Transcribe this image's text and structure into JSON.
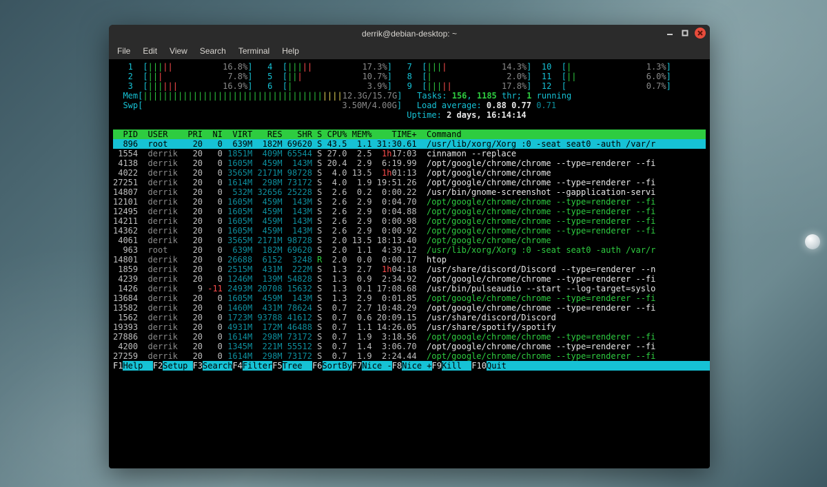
{
  "window": {
    "title": "derrik@debian-desktop: ~",
    "menu": [
      "File",
      "Edit",
      "View",
      "Search",
      "Terminal",
      "Help"
    ]
  },
  "cpu": [
    {
      "n": "1",
      "pct": "16.8%",
      "bars": "GGGRR"
    },
    {
      "n": "2",
      "pct": "7.8%",
      "bars": "GGR"
    },
    {
      "n": "3",
      "pct": "16.9%",
      "bars": "GGGRRR"
    },
    {
      "n": "4",
      "pct": "17.3%",
      "bars": "GGGRR"
    },
    {
      "n": "5",
      "pct": "10.7%",
      "bars": "GGR"
    },
    {
      "n": "6",
      "pct": "3.9%",
      "bars": "G"
    },
    {
      "n": "7",
      "pct": "14.3%",
      "bars": "GGGR"
    },
    {
      "n": "8",
      "pct": "2.0%",
      "bars": "G"
    },
    {
      "n": "9",
      "pct": "17.8%",
      "bars": "GGGRR"
    },
    {
      "n": "10",
      "pct": "1.3%",
      "bars": "G"
    },
    {
      "n": "11",
      "pct": "6.0%",
      "bars": "GG"
    },
    {
      "n": "12",
      "pct": "0.7%",
      "bars": ""
    }
  ],
  "mem": {
    "label": "Mem",
    "used": "12.3G",
    "total": "15.7G"
  },
  "swp": {
    "label": "Swp",
    "used": "3.50M",
    "total": "4.00G"
  },
  "tasks": {
    "label": "Tasks: ",
    "procs": "156",
    "sep1": ", ",
    "thr": "1185",
    "thr_lbl": " thr; ",
    "run": "1",
    "run_lbl": " running"
  },
  "load": {
    "label": "Load average: ",
    "l1": "0.88",
    "l2": "0.77",
    "l3": "0.71"
  },
  "uptime": {
    "label": "Uptime: ",
    "val": "2 days, 16:14:14"
  },
  "columns": [
    "PID",
    "USER",
    "PRI",
    "NI",
    "VIRT",
    "RES",
    "SHR",
    "S",
    "CPU%",
    "MEM%",
    "TIME+",
    "Command"
  ],
  "processes": [
    {
      "pid": "896",
      "user": "root",
      "pri": "20",
      "ni": "0",
      "virt": "639M",
      "res": "182M",
      "shr": "69620",
      "s": "S",
      "cpu": "43.5",
      "mem": "1.1",
      "time": "31:30.61",
      "cmd": "/usr/lib/xorg/Xorg :0 -seat seat0 -auth /var/r",
      "sel": true,
      "time_red": false,
      "cmd_green": false
    },
    {
      "pid": "1554",
      "user": "derrik",
      "pri": "20",
      "ni": "0",
      "virt": "1851M",
      "res": "409M",
      "shr": "65544",
      "s": "S",
      "cpu": "27.0",
      "mem": "2.5",
      "time": "1h17:03",
      "cmd": "cinnamon --replace",
      "time_red": true
    },
    {
      "pid": "4138",
      "user": "derrik",
      "pri": "20",
      "ni": "0",
      "virt": "1605M",
      "res": "459M",
      "shr": "143M",
      "s": "S",
      "cpu": "20.4",
      "mem": "2.9",
      "time": "6:19.99",
      "cmd": "/opt/google/chrome/chrome --type=renderer --fi"
    },
    {
      "pid": "4022",
      "user": "derrik",
      "pri": "20",
      "ni": "0",
      "virt": "3565M",
      "res": "2171M",
      "shr": "98728",
      "s": "S",
      "cpu": "4.0",
      "mem": "13.5",
      "time": "1h01:13",
      "cmd": "/opt/google/chrome/chrome",
      "time_red": true
    },
    {
      "pid": "27251",
      "user": "derrik",
      "pri": "20",
      "ni": "0",
      "virt": "1614M",
      "res": "298M",
      "shr": "73172",
      "s": "S",
      "cpu": "4.0",
      "mem": "1.9",
      "time": "19:51.26",
      "cmd": "/opt/google/chrome/chrome --type=renderer --fi"
    },
    {
      "pid": "14807",
      "user": "derrik",
      "pri": "20",
      "ni": "0",
      "virt": "532M",
      "res": "32656",
      "shr": "25228",
      "s": "S",
      "cpu": "2.6",
      "mem": "0.2",
      "time": "0:00.22",
      "cmd": "/usr/bin/gnome-screenshot --gapplication-servi"
    },
    {
      "pid": "12101",
      "user": "derrik",
      "pri": "20",
      "ni": "0",
      "virt": "1605M",
      "res": "459M",
      "shr": "143M",
      "s": "S",
      "cpu": "2.6",
      "mem": "2.9",
      "time": "0:04.70",
      "cmd": "/opt/google/chrome/chrome --type=renderer --fi",
      "cmd_green": true
    },
    {
      "pid": "12495",
      "user": "derrik",
      "pri": "20",
      "ni": "0",
      "virt": "1605M",
      "res": "459M",
      "shr": "143M",
      "s": "S",
      "cpu": "2.6",
      "mem": "2.9",
      "time": "0:04.88",
      "cmd": "/opt/google/chrome/chrome --type=renderer --fi",
      "cmd_green": true
    },
    {
      "pid": "14211",
      "user": "derrik",
      "pri": "20",
      "ni": "0",
      "virt": "1605M",
      "res": "459M",
      "shr": "143M",
      "s": "S",
      "cpu": "2.6",
      "mem": "2.9",
      "time": "0:00.98",
      "cmd": "/opt/google/chrome/chrome --type=renderer --fi",
      "cmd_green": true
    },
    {
      "pid": "14362",
      "user": "derrik",
      "pri": "20",
      "ni": "0",
      "virt": "1605M",
      "res": "459M",
      "shr": "143M",
      "s": "S",
      "cpu": "2.6",
      "mem": "2.9",
      "time": "0:00.92",
      "cmd": "/opt/google/chrome/chrome --type=renderer --fi",
      "cmd_green": true
    },
    {
      "pid": "4061",
      "user": "derrik",
      "pri": "20",
      "ni": "0",
      "virt": "3565M",
      "res": "2171M",
      "shr": "98728",
      "s": "S",
      "cpu": "2.0",
      "mem": "13.5",
      "time": "18:13.40",
      "cmd": "/opt/google/chrome/chrome",
      "cmd_green": true
    },
    {
      "pid": "963",
      "user": "root",
      "pri": "20",
      "ni": "0",
      "virt": "639M",
      "res": "182M",
      "shr": "69620",
      "s": "S",
      "cpu": "2.0",
      "mem": "1.1",
      "time": "4:39.12",
      "cmd": "/usr/lib/xorg/Xorg :0 -seat seat0 -auth /var/r",
      "cmd_green": true
    },
    {
      "pid": "14801",
      "user": "derrik",
      "pri": "20",
      "ni": "0",
      "virt": "26688",
      "res": "6152",
      "shr": "3248",
      "s": "R",
      "cpu": "2.0",
      "mem": "0.0",
      "time": "0:00.17",
      "cmd": "htop",
      "s_green": true
    },
    {
      "pid": "1859",
      "user": "derrik",
      "pri": "20",
      "ni": "0",
      "virt": "2515M",
      "res": "431M",
      "shr": "222M",
      "s": "S",
      "cpu": "1.3",
      "mem": "2.7",
      "time": "1h04:18",
      "cmd": "/usr/share/discord/Discord --type=renderer --n",
      "time_red": true
    },
    {
      "pid": "4239",
      "user": "derrik",
      "pri": "20",
      "ni": "0",
      "virt": "1246M",
      "res": "139M",
      "shr": "54828",
      "s": "S",
      "cpu": "1.3",
      "mem": "0.9",
      "time": "2:34.92",
      "cmd": "/opt/google/chrome/chrome --type=renderer --fi"
    },
    {
      "pid": "1426",
      "user": "derrik",
      "pri": "9",
      "ni": "-11",
      "virt": "2493M",
      "res": "20708",
      "shr": "15632",
      "s": "S",
      "cpu": "1.3",
      "mem": "0.1",
      "time": "17:08.68",
      "cmd": "/usr/bin/pulseaudio --start --log-target=syslo",
      "ni_red": true
    },
    {
      "pid": "13684",
      "user": "derrik",
      "pri": "20",
      "ni": "0",
      "virt": "1605M",
      "res": "459M",
      "shr": "143M",
      "s": "S",
      "cpu": "1.3",
      "mem": "2.9",
      "time": "0:01.85",
      "cmd": "/opt/google/chrome/chrome --type=renderer --fi",
      "cmd_green": true
    },
    {
      "pid": "13582",
      "user": "derrik",
      "pri": "20",
      "ni": "0",
      "virt": "1460M",
      "res": "431M",
      "shr": "78624",
      "s": "S",
      "cpu": "0.7",
      "mem": "2.7",
      "time": "10:48.29",
      "cmd": "/opt/google/chrome/chrome --type=renderer --fi"
    },
    {
      "pid": "1562",
      "user": "derrik",
      "pri": "20",
      "ni": "0",
      "virt": "1723M",
      "res": "93788",
      "shr": "41612",
      "s": "S",
      "cpu": "0.7",
      "mem": "0.6",
      "time": "20:09.15",
      "cmd": "/usr/share/discord/Discord"
    },
    {
      "pid": "19393",
      "user": "derrik",
      "pri": "20",
      "ni": "0",
      "virt": "4931M",
      "res": "172M",
      "shr": "46488",
      "s": "S",
      "cpu": "0.7",
      "mem": "1.1",
      "time": "14:26.05",
      "cmd": "/usr/share/spotify/spotify"
    },
    {
      "pid": "27886",
      "user": "derrik",
      "pri": "20",
      "ni": "0",
      "virt": "1614M",
      "res": "298M",
      "shr": "73172",
      "s": "S",
      "cpu": "0.7",
      "mem": "1.9",
      "time": "3:18.56",
      "cmd": "/opt/google/chrome/chrome --type=renderer --fi",
      "cmd_green": true
    },
    {
      "pid": "4200",
      "user": "derrik",
      "pri": "20",
      "ni": "0",
      "virt": "1345M",
      "res": "221M",
      "shr": "55512",
      "s": "S",
      "cpu": "0.7",
      "mem": "1.4",
      "time": "3:06.70",
      "cmd": "/opt/google/chrome/chrome --type=renderer --fi"
    },
    {
      "pid": "27259",
      "user": "derrik",
      "pri": "20",
      "ni": "0",
      "virt": "1614M",
      "res": "298M",
      "shr": "73172",
      "s": "S",
      "cpu": "0.7",
      "mem": "1.9",
      "time": "2:24.44",
      "cmd": "/opt/google/chrome/chrome --type=renderer --fi",
      "cmd_green": true
    }
  ],
  "fnkeys": [
    {
      "k": "F1",
      "l": "Help  "
    },
    {
      "k": "F2",
      "l": "Setup "
    },
    {
      "k": "F3",
      "l": "Search"
    },
    {
      "k": "F4",
      "l": "Filter"
    },
    {
      "k": "F5",
      "l": "Tree  "
    },
    {
      "k": "F6",
      "l": "SortBy"
    },
    {
      "k": "F7",
      "l": "Nice -"
    },
    {
      "k": "F8",
      "l": "Nice +"
    },
    {
      "k": "F9",
      "l": "Kill  "
    },
    {
      "k": "F10",
      "l": "Quit  "
    }
  ]
}
